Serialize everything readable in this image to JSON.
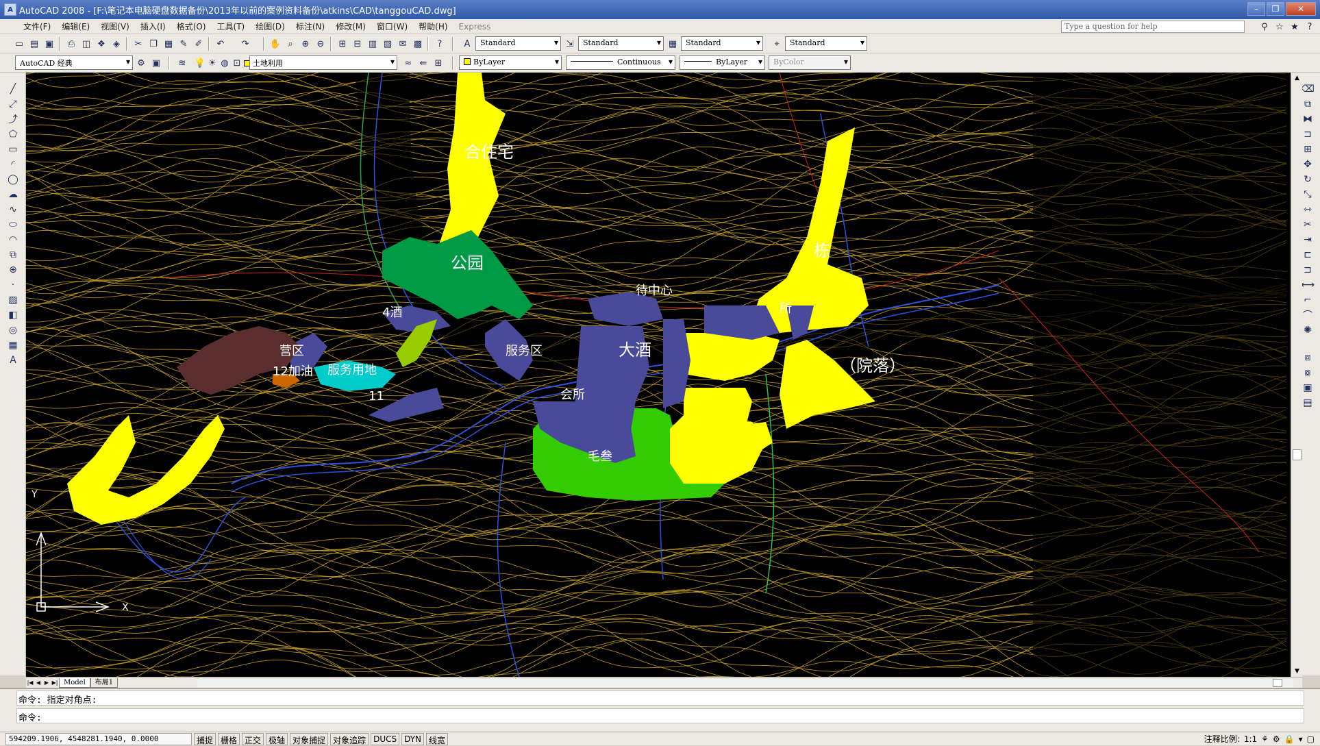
{
  "window": {
    "app_icon": "A",
    "title": "AutoCAD 2008 - [F:\\笔记本电脑硬盘数据备份\\2013年以前的案例资料备份\\atkins\\CAD\\tanggouCAD.dwg]",
    "btn_minimize": "–",
    "btn_restore": "❐",
    "btn_close": "✕"
  },
  "menubar": {
    "items": [
      "文件(F)",
      "编辑(E)",
      "视图(V)",
      "插入(I)",
      "格式(O)",
      "工具(T)",
      "绘图(D)",
      "标注(N)",
      "修改(M)",
      "窗口(W)",
      "帮助(H)",
      "Express"
    ],
    "help_placeholder": "Type a question for help"
  },
  "toolbar1": {
    "text_style": "Standard",
    "dim_style": "Standard",
    "table_style": "Standard",
    "mleader_style": "Standard"
  },
  "toolbar2": {
    "workspace": "AutoCAD 经典",
    "layer": "土地利用",
    "color": "ByLayer",
    "color_swatch": "#ffff00",
    "linetype": "Continuous",
    "lineweight": "ByLayer",
    "plotstyle": "ByColor"
  },
  "drawing": {
    "background": "#000000",
    "contour_color": "#c9a227",
    "labels": [
      "合住宅",
      "公园",
      "栋",
      "待中心",
      "大酒",
      "（院落）",
      "服务区",
      "营区",
      "12加油",
      "服务用地",
      "会所",
      "毛叁",
      "所",
      "4酒",
      "11"
    ]
  },
  "tabs": {
    "model": "Model",
    "layout1": "布局1"
  },
  "command": {
    "history": "命令: 指定对角点:",
    "prompt": "命令:"
  },
  "statusbar": {
    "coordinates": "594209.1906, 4548281.1940, 0.0000",
    "toggles": [
      "捕捉",
      "栅格",
      "正交",
      "极轴",
      "对象捕捉",
      "对象追踪",
      "DUCS",
      "DYN",
      "线宽"
    ],
    "annotation_scale_label": "注释比例:",
    "annotation_scale": "1:1"
  }
}
